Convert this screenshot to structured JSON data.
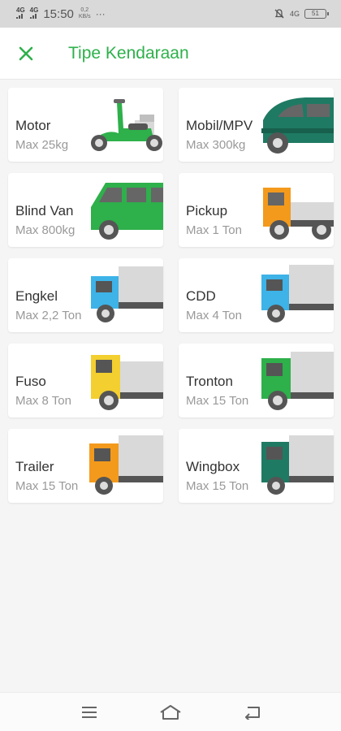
{
  "status_bar": {
    "network_1": "4G",
    "network_2": "4G",
    "time": "15:50",
    "speed_value": "0,2",
    "speed_unit": "KB/s",
    "dots": "···",
    "signal": "4G",
    "battery": "51"
  },
  "header": {
    "title": "Tipe Kendaraan",
    "close_icon": "close-icon"
  },
  "vehicles": [
    {
      "name": "Motor",
      "capacity": "Max 25kg",
      "icon": "scooter-icon",
      "color": "#2eb04b"
    },
    {
      "name": "Mobil/MPV",
      "capacity": "Max 300kg",
      "icon": "car-icon",
      "color": "#1f7a63"
    },
    {
      "name": "Blind Van",
      "capacity": "Max 800kg",
      "icon": "van-icon",
      "color": "#2eb04b"
    },
    {
      "name": "Pickup",
      "capacity": "Max 1 Ton",
      "icon": "pickup-icon",
      "color": "#f39a1c"
    },
    {
      "name": "Engkel",
      "capacity": "Max 2,2 Ton",
      "icon": "truck-icon",
      "color": "#3db3e8"
    },
    {
      "name": "CDD",
      "capacity": "Max 4 Ton",
      "icon": "box-truck-icon",
      "color": "#3db3e8"
    },
    {
      "name": "Fuso",
      "capacity": "Max 8 Ton",
      "icon": "truck-icon",
      "color": "#f3cf2f"
    },
    {
      "name": "Tronton",
      "capacity": "Max 15 Ton",
      "icon": "truck-icon",
      "color": "#2eb04b"
    },
    {
      "name": "Trailer",
      "capacity": "Max 15 Ton",
      "icon": "truck-icon",
      "color": "#f39a1c"
    },
    {
      "name": "Wingbox",
      "capacity": "Max 15 Ton",
      "icon": "box-truck-icon",
      "color": "#1f7a63"
    }
  ],
  "nav": {
    "menu_icon": "menu-icon",
    "home_icon": "home-icon",
    "back_icon": "back-icon"
  },
  "colors": {
    "accent": "#2eb04b",
    "muted_text": "#999999"
  }
}
